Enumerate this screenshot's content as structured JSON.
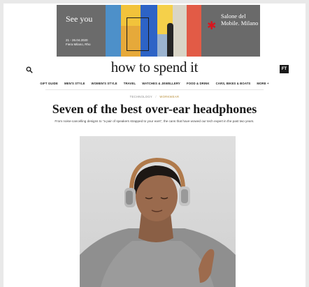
{
  "ad": {
    "headline": "See you",
    "dates": "21 - 26.04.2020",
    "venue": "Fiera Milano, Rho",
    "brand": "Salone del Mobile. Milano",
    "colors": {
      "yellow": "#f2c33b",
      "blue": "#2d63c6",
      "red": "#d7161e"
    }
  },
  "header": {
    "search_icon": "search-icon",
    "logo": "how to spend it",
    "ft_badge": "FT"
  },
  "nav": {
    "items": [
      "GIFT GUIDE",
      "MEN'S STYLE",
      "WOMEN'S STYLE",
      "TRAVEL",
      "WATCHES & JEWELLERY",
      "FOOD & DRINK",
      "CARS, BIKES & BOATS",
      "MORE +"
    ]
  },
  "article": {
    "breadcrumb": [
      "TECHNOLOGY",
      "/",
      "WORKWEAR"
    ],
    "title": "Seven of the best over-ear headphones",
    "standfirst": "From noise-cancelling designs to \"a pair of speakers strapped to your ears\", the cans that have wowed our tech expert in the past two years.",
    "accent_color": "#b98f3b"
  }
}
